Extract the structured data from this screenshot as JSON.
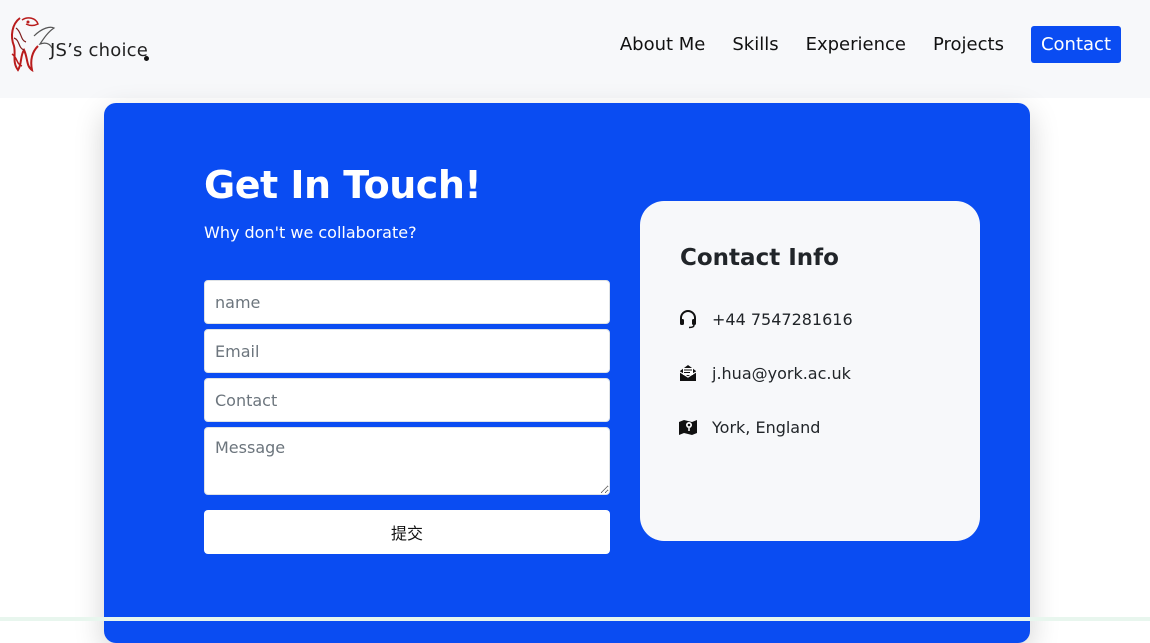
{
  "brand": {
    "logo_text": "JS’s choice"
  },
  "nav": {
    "items": [
      {
        "label": "About Me"
      },
      {
        "label": "Skills"
      },
      {
        "label": "Experience"
      },
      {
        "label": "Projects"
      },
      {
        "label": "Contact"
      }
    ],
    "active": "Contact",
    "accent_color": "#0a4cf2"
  },
  "contact": {
    "heading": "Get In Touch!",
    "subheading": "Why don't we collaborate?",
    "form": {
      "name_placeholder": "name",
      "email_placeholder": "Email",
      "contact_placeholder": "Contact",
      "message_placeholder": "Message",
      "submit_label": "提交"
    },
    "info": {
      "title": "Contact Info",
      "phone": "+44 7547281616",
      "email": "j.hua@york.ac.uk",
      "location": "York, England",
      "phone_icon": "headset-icon",
      "email_icon": "envelope-open-icon",
      "location_icon": "map-icon"
    }
  }
}
